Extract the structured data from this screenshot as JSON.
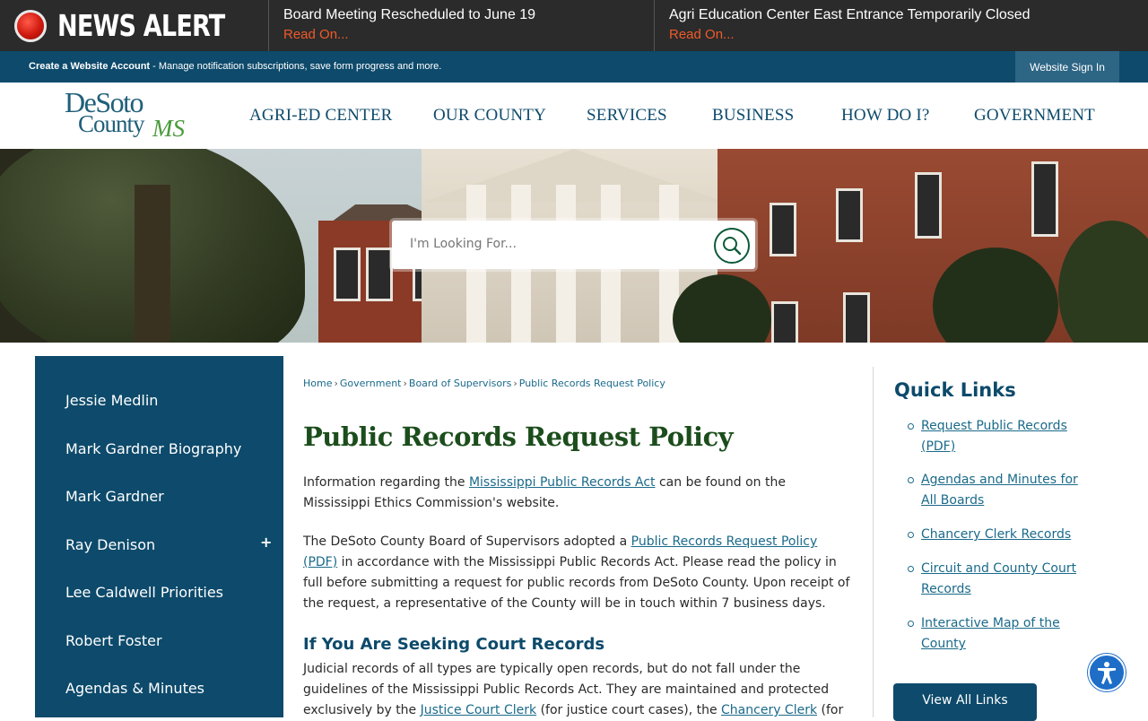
{
  "alert": {
    "title": "NEWS ALERT",
    "items": [
      {
        "headline": "Board Meeting Rescheduled to June 19",
        "link": "Read On..."
      },
      {
        "headline": "Agri Education Center East Entrance Temporarily Closed",
        "link": "Read On..."
      }
    ]
  },
  "account": {
    "create_label": "Create a Website Account",
    "create_desc": " - Manage notification subscriptions, save form progress and more.",
    "signin_label": "Website Sign In"
  },
  "logo": {
    "line1": "DeSoto",
    "line2": "County",
    "line3": "MS"
  },
  "nav": [
    "AGRI-ED CENTER",
    "OUR COUNTY",
    "SERVICES",
    "BUSINESS",
    "HOW DO I?",
    "GOVERNMENT"
  ],
  "search": {
    "placeholder": "I'm Looking For..."
  },
  "sidebar": {
    "items": [
      "Jessie Medlin",
      "Mark Gardner Biography",
      "Mark Gardner",
      "Ray Denison",
      "Lee Caldwell Priorities",
      "Robert Foster",
      "Agendas & Minutes"
    ],
    "expand_symbol": "+"
  },
  "breadcrumb": {
    "home": "Home",
    "government": "Government",
    "board": "Board of Supervisors",
    "current": "Public Records Request Policy",
    "sep": "›"
  },
  "page": {
    "title": "Public Records Request Policy",
    "p1_before": "Information regarding the ",
    "p1_link": "Mississippi Public Records Act",
    "p1_after": " can be found on the Mississippi Ethics Commission's website.",
    "p2_before": "The DeSoto County Board of Supervisors adopted a ",
    "p2_link": "Public Records Request Policy (PDF)",
    "p2_after": " in accordance with the Mississippi Public Records Act. Please read the policy in full before submitting a request for public records from DeSoto County. Upon receipt of the request, a representative of the County will be in touch within 7 business days.",
    "subheading": "If You Are Seeking Court Records",
    "p3_before": "Judicial records of all types are typically open records, but do not fall under the guidelines of the Mississippi Public Records Act. They are maintained and protected exclusively by the ",
    "p3_link1": "Justice Court Clerk",
    "p3_mid": " (for justice court cases), the ",
    "p3_link2": "Chancery Clerk",
    "p3_after": " (for"
  },
  "quick_links": {
    "title": "Quick Links",
    "items": [
      "Request Public Records (PDF)",
      "Agendas and Minutes for All Boards",
      "Chancery Clerk Records",
      "Circuit and County Court Records",
      "Interactive Map of the County"
    ],
    "view_all": "View All Links"
  },
  "colors": {
    "primary": "#0d4a6b",
    "title_green": "#1c4d1c",
    "alert_orange": "#f05a2a",
    "link": "#1a6a8a"
  }
}
